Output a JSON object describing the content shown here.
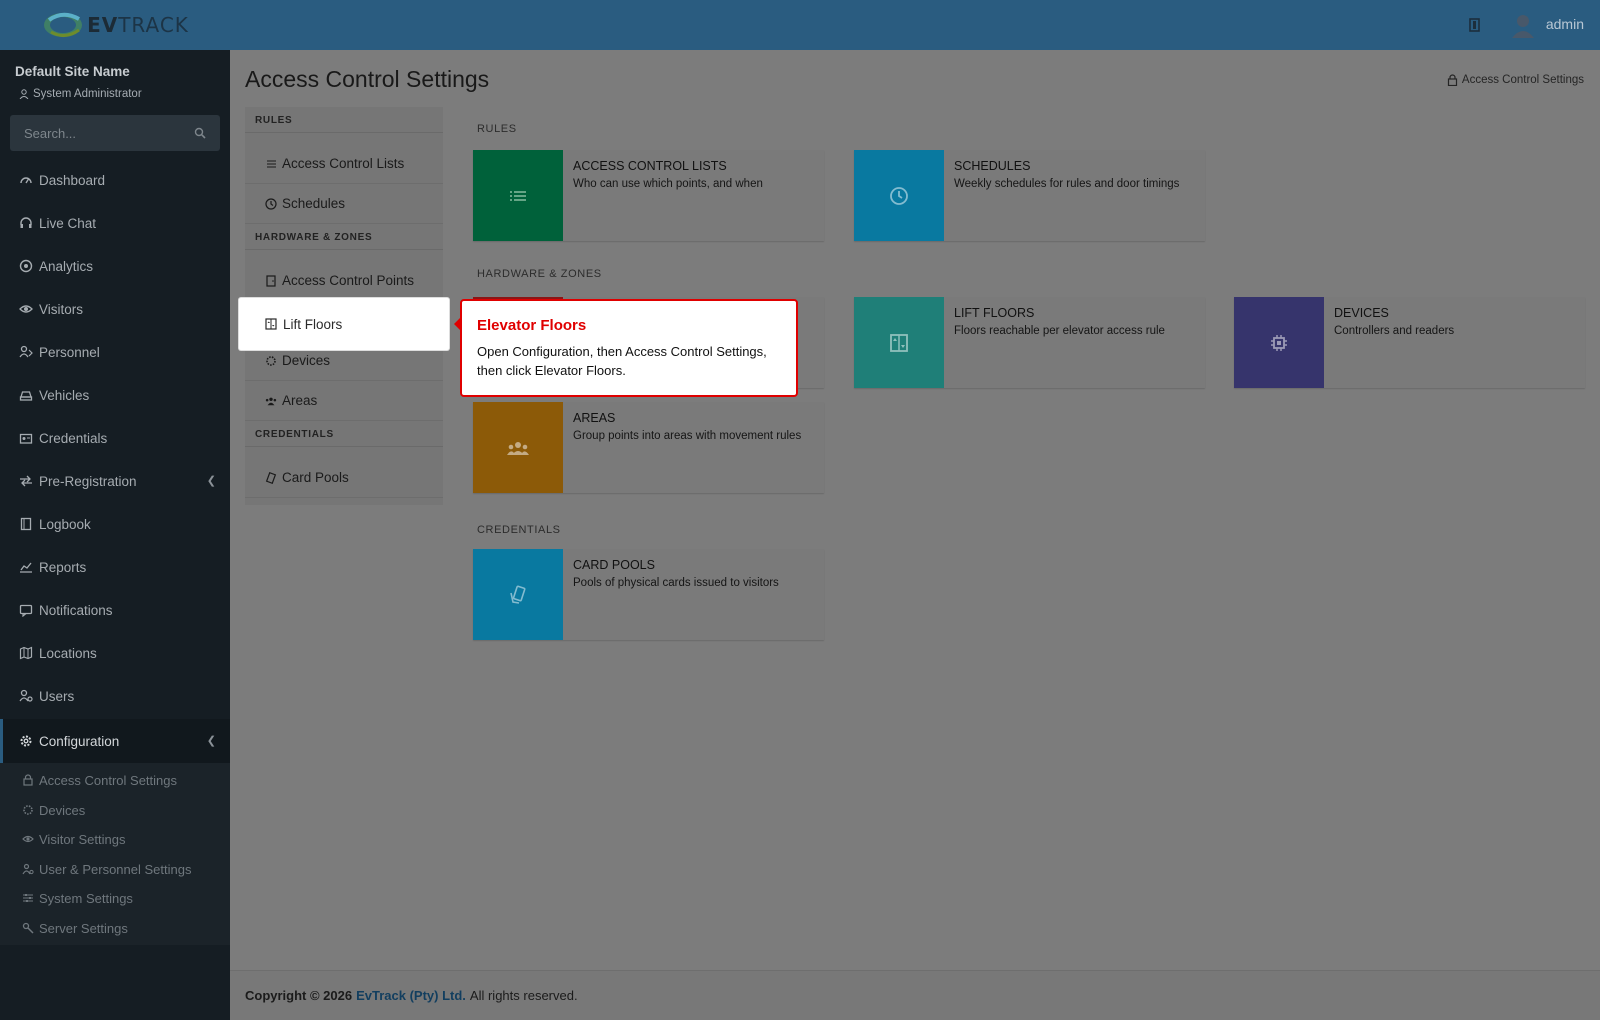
{
  "header": {
    "logo_text_bold": "EV",
    "logo_text_rest": "TRACK",
    "user_name": "admin",
    "header_color": "#2a5c80"
  },
  "sidebar": {
    "site_name": "Default Site Name",
    "role": "System Administrator",
    "search_placeholder": "Search...",
    "items": [
      {
        "label": "Dashboard",
        "icon": "dashboard-icon"
      },
      {
        "label": "Live Chat",
        "icon": "headset-icon"
      },
      {
        "label": "Analytics",
        "icon": "analytics-icon"
      },
      {
        "label": "Visitors",
        "icon": "eye-icon"
      },
      {
        "label": "Personnel",
        "icon": "personnel-icon"
      },
      {
        "label": "Vehicles",
        "icon": "car-icon"
      },
      {
        "label": "Credentials",
        "icon": "id-card-icon"
      },
      {
        "label": "Pre-Registration",
        "icon": "arrows-icon"
      },
      {
        "label": "Logbook",
        "icon": "book-icon"
      },
      {
        "label": "Reports",
        "icon": "chart-icon"
      },
      {
        "label": "Notifications",
        "icon": "notification-icon"
      },
      {
        "label": "Locations",
        "icon": "map-icon"
      },
      {
        "label": "Users",
        "icon": "users-icon"
      },
      {
        "label": "Configuration",
        "icon": "gear-icon"
      }
    ],
    "sub_items": [
      {
        "label": "Access Control Settings",
        "icon": "lock-icon"
      },
      {
        "label": "Devices",
        "icon": "chip-icon"
      },
      {
        "label": "Visitor Settings",
        "icon": "eye-icon"
      },
      {
        "label": "User & Personnel Settings",
        "icon": "user-gear-icon"
      },
      {
        "label": "System Settings",
        "icon": "sliders-icon"
      },
      {
        "label": "Server Settings",
        "icon": "server-icon"
      }
    ]
  },
  "page": {
    "title": "Access Control Settings",
    "breadcrumb": "Access Control Settings"
  },
  "leftnav": {
    "sections": [
      {
        "label": "RULES"
      },
      {
        "label": "HARDWARE & ZONES"
      },
      {
        "label": "CREDENTIALS"
      }
    ],
    "items": [
      {
        "label": "Access Control Lists"
      },
      {
        "label": "Schedules"
      },
      {
        "label": "Access Control Points"
      },
      {
        "label": "Lift Floors"
      },
      {
        "label": "Devices"
      },
      {
        "label": "Areas"
      },
      {
        "label": "Card Pools"
      }
    ]
  },
  "main": {
    "sections": [
      "RULES",
      "HARDWARE & ZONES",
      "CREDENTIALS"
    ],
    "cards": [
      {
        "title": "Access Control Lists",
        "desc": "Who can use which points, and when",
        "color": "#00613a"
      },
      {
        "title": "Schedules",
        "desc": "Weekly schedules for rules and door timings",
        "color": "#0979a0"
      },
      {
        "title": "Lift Floors",
        "desc": "Floors reachable per elevator access rule",
        "color": "#1f7f78"
      },
      {
        "title": "Devices",
        "desc": "Controllers and readers",
        "color": "#36346c"
      },
      {
        "title": "Areas",
        "desc": "Group points into areas with movement rules",
        "color": "#8c5a08"
      },
      {
        "title": "Card Pools",
        "desc": "Pools of physical cards issued to visitors",
        "color": "#0979a0"
      }
    ]
  },
  "tooltip": {
    "title": "Elevator Floors",
    "body": "Open Configuration, then Access Control Settings, then click Elevator Floors."
  },
  "footer": {
    "prefix": "Copyright © 2026",
    "company": "EvTrack (Pty) Ltd.",
    "suffix": "All rights reserved."
  }
}
